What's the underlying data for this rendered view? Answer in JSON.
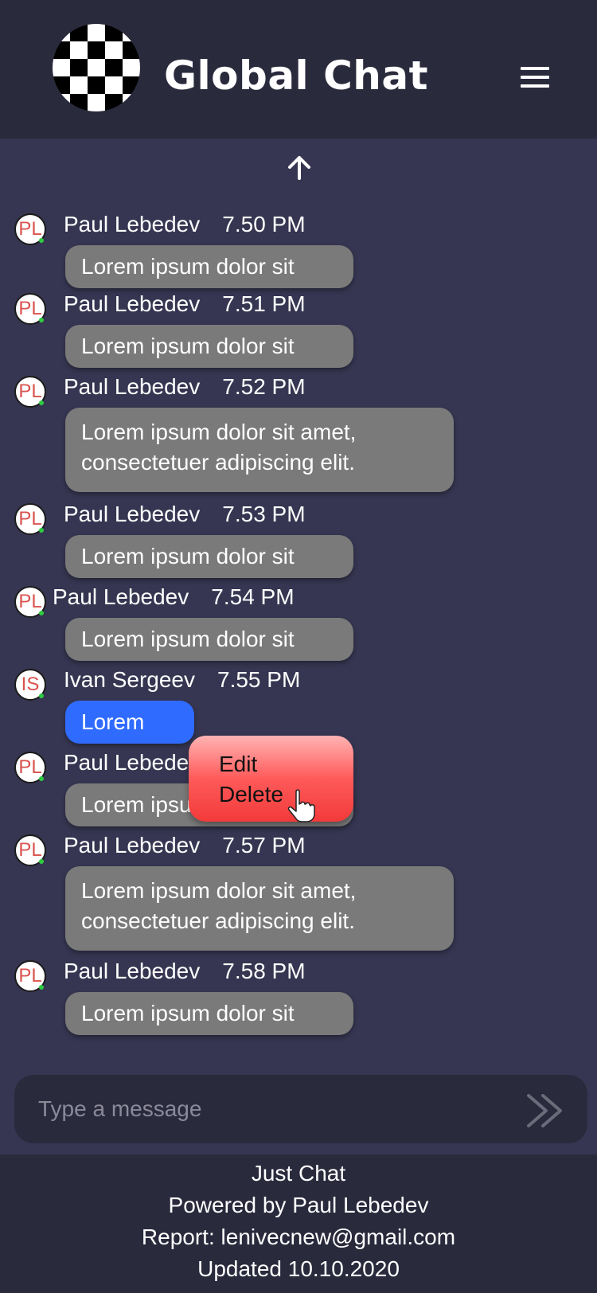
{
  "header": {
    "title": "Global Chat"
  },
  "messages": [
    {
      "initials": "PL",
      "author": "Paul Lebedev",
      "time": "7.50 PM",
      "text": "Lorem ipsum dolor sit"
    },
    {
      "initials": "PL",
      "author": "Paul Lebedev",
      "time": "7.51 PM",
      "text": "Lorem ipsum dolor sit"
    },
    {
      "initials": "PL",
      "author": "Paul Lebedev",
      "time": "7.52 PM",
      "text": "Lorem ipsum dolor sit amet,",
      "text2": "consectetuer adipiscing elit."
    },
    {
      "initials": "PL",
      "author": "Paul Lebedev",
      "time": "7.53 PM",
      "text": "Lorem ipsum dolor sit"
    },
    {
      "initials": "PL",
      "author": "Paul Lebedev",
      "time": "7.54 PM",
      "text": "Lorem ipsum dolor sit"
    },
    {
      "initials": "IS",
      "author": "Ivan Sergeev",
      "time": "7.55 PM",
      "text": "Lorem"
    },
    {
      "initials": "PL",
      "author": "Paul Lebede",
      "text": "Lorem ipsu"
    },
    {
      "initials": "PL",
      "author": "Paul Lebedev",
      "time": "7.57 PM",
      "text": "Lorem ipsum dolor sit amet,",
      "text2": "consectetuer adipiscing elit."
    },
    {
      "initials": "PL",
      "author": "Paul Lebedev",
      "time": "7.58 PM",
      "text": "Lorem ipsum dolor sit"
    }
  ],
  "context_menu": {
    "edit": "Edit",
    "delete": "Delete"
  },
  "composer": {
    "placeholder": "Type a message"
  },
  "footer": {
    "line1": "Just Chat",
    "line2": "Powered by Paul Lebedev",
    "line3": "Report:  lenivecnew@gmail.com",
    "line4": "Updated 10.10.2020"
  },
  "colors": {
    "background": "#363652",
    "header": "#2a2a3d",
    "bubble": "#7a7a7a",
    "own_bubble": "#2f6bff",
    "context_menu": "#f23a3a",
    "online": "#2ecc40"
  },
  "icons": {
    "logo": "checkered-logo-icon",
    "menu": "hamburger-menu-icon",
    "scroll_up": "arrow-up-icon",
    "send": "double-chevron-send-icon",
    "cursor": "hand-pointer-icon"
  }
}
